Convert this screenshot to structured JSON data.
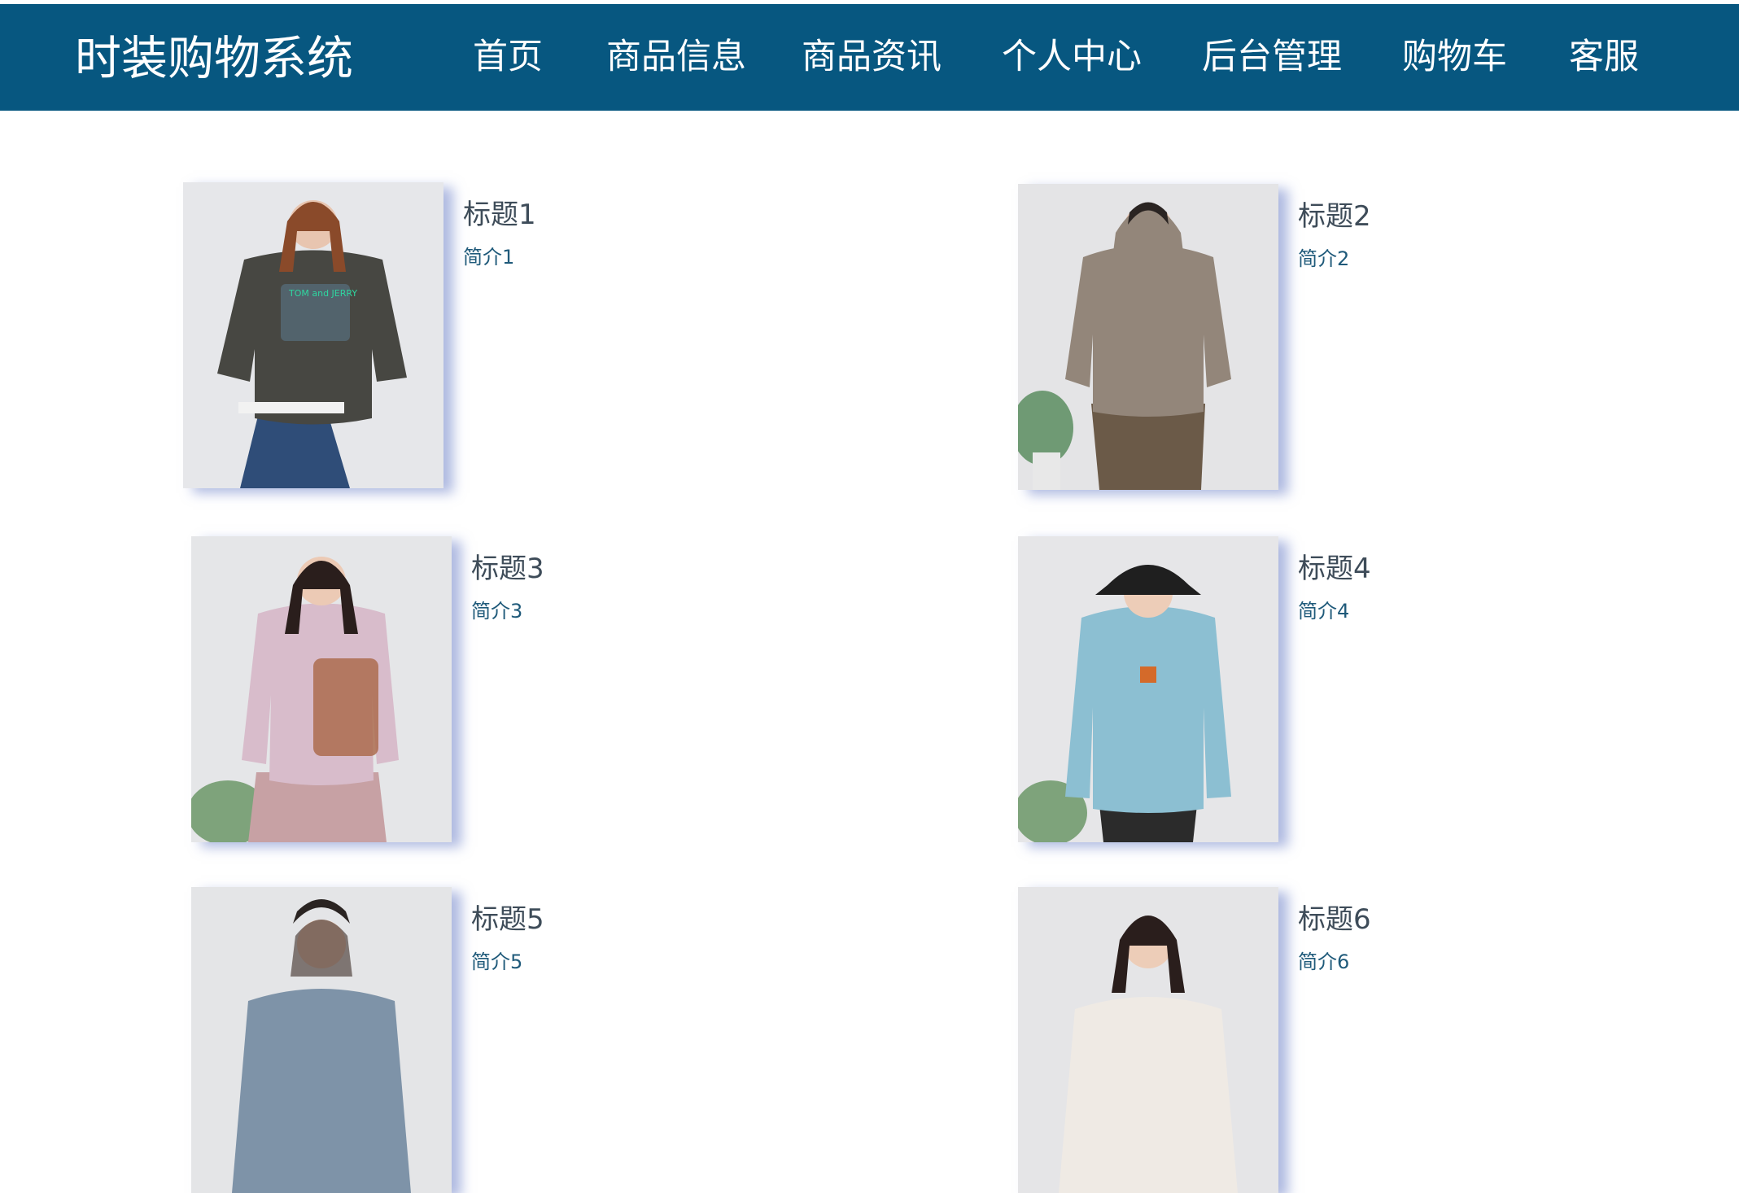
{
  "header": {
    "brand": "时装购物系统",
    "nav": [
      {
        "label": "首页"
      },
      {
        "label": "商品信息"
      },
      {
        "label": "商品资讯",
        "active": true
      },
      {
        "label": "个人中心"
      },
      {
        "label": "后台管理"
      },
      {
        "label": "购物车"
      },
      {
        "label": "客服"
      }
    ]
  },
  "colors": {
    "header_bg": "#075780",
    "title_text": "#3e4c59",
    "intro_text": "#1f5a7a"
  },
  "articles": [
    {
      "title": "标题1",
      "intro": "简介1",
      "image_print": "TOM and JERRY",
      "garment_color": "#474742"
    },
    {
      "title": "标题2",
      "intro": "简介2",
      "garment_color": "#93867a"
    },
    {
      "title": "标题3",
      "intro": "简介3",
      "garment_color": "#d8bccb"
    },
    {
      "title": "标题4",
      "intro": "简介4",
      "garment_color": "#8cbfd2"
    },
    {
      "title": "标题5",
      "intro": "简介5",
      "garment_color": "#7e93a8"
    },
    {
      "title": "标题6",
      "intro": "简介6",
      "garment_color": "#efeae4"
    }
  ]
}
